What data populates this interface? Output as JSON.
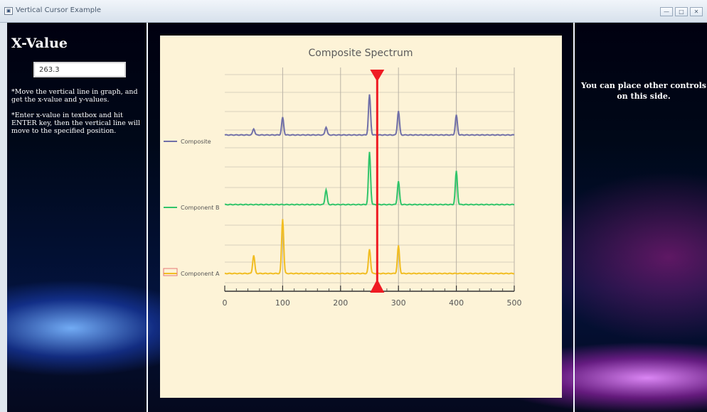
{
  "window": {
    "title": "Vertical Cursor Example",
    "buttons": [
      {
        "name": "minimize-button",
        "glyph": "—"
      },
      {
        "name": "maximize-button",
        "glyph": "□"
      },
      {
        "name": "close-button",
        "glyph": "✕"
      }
    ]
  },
  "left_panel": {
    "title": "X-Value",
    "xvalue_input": "263.3",
    "instruction_1": "*Move the vertical line in graph, and get the x-value and y-values.",
    "instruction_2": "*Enter x-value in textbox and hit ENTER key, then the vertical line will move to the specified position."
  },
  "right_panel": {
    "note": "You can place other controls on this side."
  },
  "colors": {
    "composite": "#7170a8",
    "component_b": "#31c46a",
    "component_a": "#f1bd22",
    "cursor": "#ef1b23",
    "grid": "#b9b2a6"
  },
  "chart_data": {
    "type": "line",
    "title": "Composite Spectrum",
    "xlim": [
      0,
      500
    ],
    "xticks": [
      0,
      100,
      200,
      300,
      400,
      500
    ],
    "cursor_x": 263.3,
    "series": [
      {
        "name": "Composite",
        "peaks": [
          {
            "x": 50,
            "h": 0.22
          },
          {
            "x": 100,
            "h": 0.62
          },
          {
            "x": 175,
            "h": 0.28
          },
          {
            "x": 250,
            "h": 1.42
          },
          {
            "x": 300,
            "h": 0.85
          },
          {
            "x": 400,
            "h": 0.7
          }
        ]
      },
      {
        "name": "Component B",
        "peaks": [
          {
            "x": 175,
            "h": 0.52
          },
          {
            "x": 250,
            "h": 1.85
          },
          {
            "x": 300,
            "h": 0.82
          },
          {
            "x": 400,
            "h": 1.18
          }
        ]
      },
      {
        "name": "Component A",
        "peaks": [
          {
            "x": 50,
            "h": 0.64
          },
          {
            "x": 100,
            "h": 1.92
          },
          {
            "x": 250,
            "h": 0.86
          },
          {
            "x": 300,
            "h": 0.98
          }
        ]
      }
    ]
  }
}
